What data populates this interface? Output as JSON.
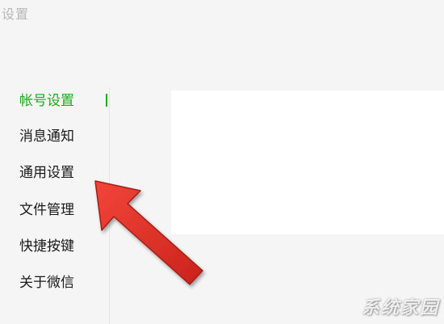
{
  "window": {
    "title": "设置"
  },
  "sidebar": {
    "items": [
      {
        "label": "帐号设置",
        "active": true
      },
      {
        "label": "消息通知",
        "active": false
      },
      {
        "label": "通用设置",
        "active": false
      },
      {
        "label": "文件管理",
        "active": false
      },
      {
        "label": "快捷按键",
        "active": false
      },
      {
        "label": "关于微信",
        "active": false
      }
    ]
  },
  "colors": {
    "accent": "#1aad19",
    "arrow": "#e8382d"
  },
  "watermark": {
    "text": "系统家园"
  }
}
